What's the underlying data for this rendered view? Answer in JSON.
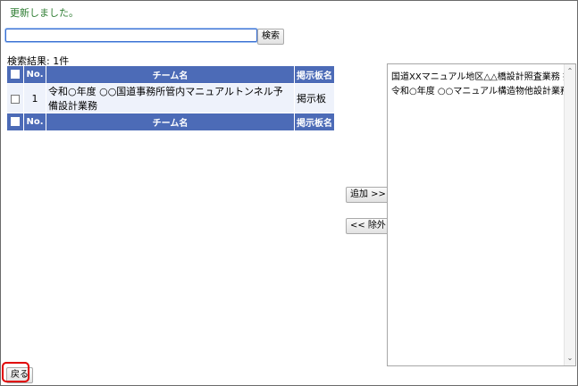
{
  "status_message": "更新しました。",
  "search": {
    "value": "",
    "button_label": "検索"
  },
  "results": {
    "count_label": "検索結果: 1件",
    "header": {
      "no": "No.",
      "team": "チーム名",
      "board": "掲示板名"
    },
    "rows": [
      {
        "no": "1",
        "team": "令和○年度 ○○国道事務所管内マニュアルトンネル予備設計業務",
        "board": "掲示板"
      }
    ]
  },
  "buttons": {
    "add": "追加 >>",
    "remove": "<< 除外",
    "back": "戻る"
  },
  "selected_list": {
    "items": [
      "国道XXマニュアル地区△△橋設計照査業務 掲示板",
      "令和○年度 ○○マニュアル構造物他設計業務 掲示板"
    ]
  },
  "scrollbar": {
    "up_glyph": "⌃",
    "down_glyph": "⌄"
  },
  "colors": {
    "table_header": "#4c6bb7",
    "status_text": "#2e7d32",
    "highlight": "#e00000"
  }
}
